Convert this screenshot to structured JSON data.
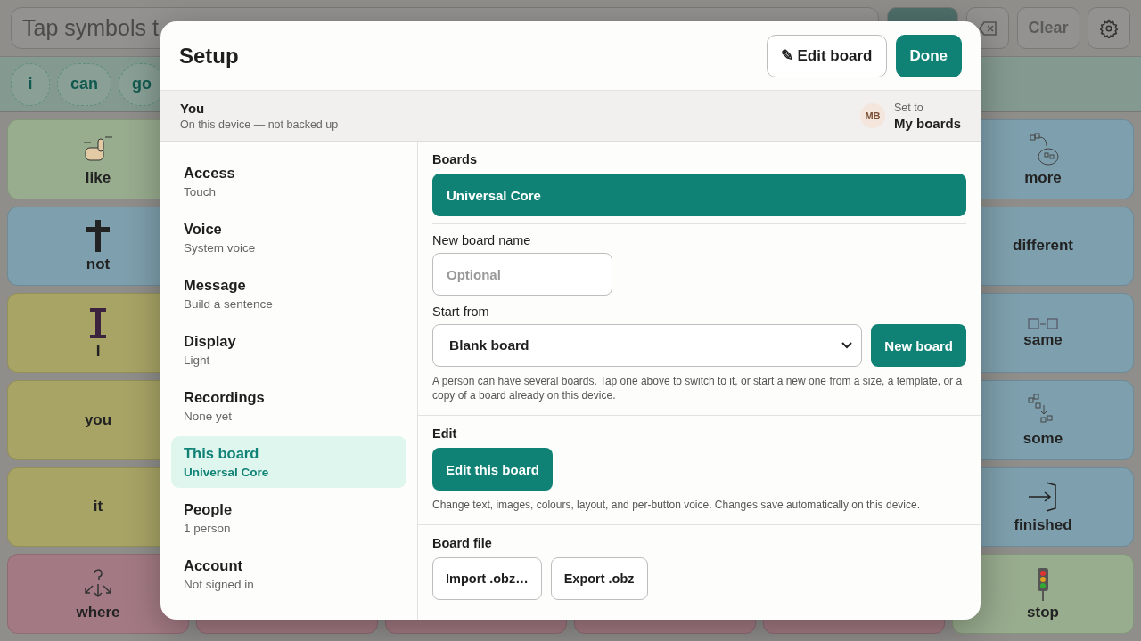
{
  "board": {
    "message_placeholder": "Tap symbols t",
    "toolbar": [
      {
        "kind": "speak"
      },
      {
        "kind": "backspace"
      },
      {
        "kind": "text",
        "label": "Clear"
      },
      {
        "kind": "settings"
      }
    ],
    "chips": [
      "i",
      "can",
      "go"
    ],
    "rows": [
      [
        {
          "label": "like",
          "color": "#98ac8e",
          "kind": "hand"
        },
        {
          "label": "more",
          "color": "#7e9fad",
          "kind": "group"
        }
      ],
      [
        {
          "label": "not",
          "color": "#7e9fad",
          "kind": "cross"
        },
        {
          "label": "different",
          "color": "#7e9fad",
          "kind": "text"
        }
      ],
      [
        {
          "label": "I",
          "color": "#a8a466",
          "kind": "letter"
        },
        {
          "label": "same",
          "color": "#7e9fad",
          "kind": "equal"
        }
      ],
      [
        {
          "label": "you",
          "color": "#a8a466",
          "kind": "text"
        },
        {
          "label": "some",
          "color": "#7e9fad",
          "kind": "scatter"
        }
      ],
      [
        {
          "label": "it",
          "color": "#a8a466",
          "kind": "text"
        },
        {
          "label": "finished",
          "color": "#7e9fad",
          "kind": "exit"
        }
      ],
      [
        {
          "label": "where",
          "color": "#a37a83",
          "kind": "question"
        },
        {
          "kind": "text"
        },
        {
          "kind": "text"
        },
        {
          "kind": "text"
        },
        {
          "kind": "text"
        },
        {
          "label": "stop",
          "color": "#98ac8e",
          "kind": "light"
        }
      ]
    ]
  },
  "dialog": {
    "title": "Setup",
    "header_buttons": [
      {
        "label": "✎ Edit board",
        "kind": "outline"
      },
      {
        "label": "Done",
        "kind": "primary"
      }
    ],
    "profile": {
      "name": "You",
      "detail": "On this device — not backed up",
      "avatar": "MB",
      "set_to_label": "Set to",
      "set_to_value": "My boards"
    },
    "nav": [
      {
        "title": "Access",
        "detail": "Touch",
        "selected": false
      },
      {
        "title": "Voice",
        "detail": "System voice",
        "selected": false
      },
      {
        "title": "Message",
        "detail": "Build a sentence",
        "selected": false
      },
      {
        "title": "Display",
        "detail": "Light",
        "selected": false
      },
      {
        "title": "Recordings",
        "detail": "None yet",
        "selected": false
      },
      {
        "title": "This board",
        "detail": "Universal Core",
        "selected": true
      },
      {
        "title": "People",
        "detail": "1 person",
        "selected": false
      },
      {
        "title": "Account",
        "detail": "Not signed in",
        "selected": false
      }
    ],
    "boards": {
      "heading": "Boards",
      "items": [
        {
          "name": "Universal Core",
          "selected": true
        }
      ],
      "name_label": "New board name",
      "name_placeholder": "Optional",
      "start_label": "Start from",
      "start_value": "Blank board",
      "create_button": "New board",
      "help": "A person can have several boards. Tap one above to switch to it, or start a new one from a size, a template, or a copy of a board already on this device."
    },
    "edit": {
      "heading": "Edit",
      "button": "Edit this board",
      "help": "Change text, images, colours, layout, and per-button voice. Changes save automatically on this device."
    },
    "file": {
      "heading": "Board file",
      "buttons": [
        "Import .obz…",
        "Export .obz"
      ]
    }
  }
}
